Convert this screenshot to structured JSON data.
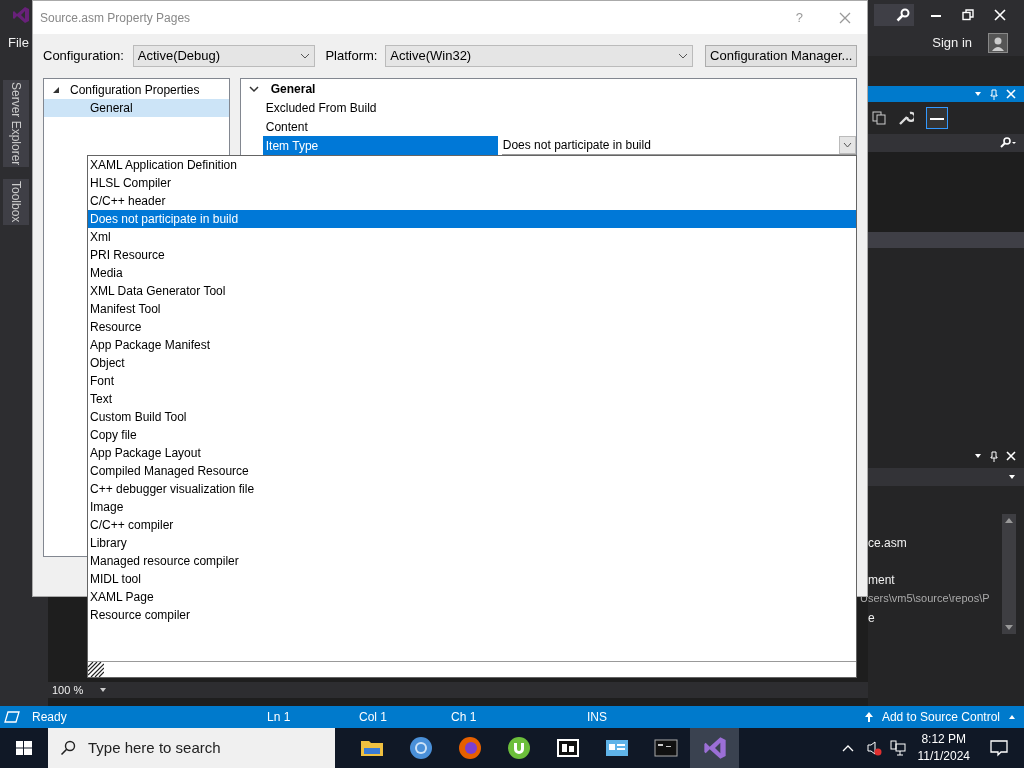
{
  "ide": {
    "menu": [
      "File"
    ],
    "sign_in": "Sign in",
    "side_tabs": [
      "Server Explorer",
      "Toolbox"
    ],
    "zoom": "100 %",
    "lower_panel_lines": [
      "ce.asm",
      "ment",
      "Users\\vm5\\source\\repos\\P",
      "e"
    ]
  },
  "dialog": {
    "title": "Source.asm Property Pages",
    "help": "?",
    "configuration_label": "Configuration:",
    "configuration_value": "Active(Debug)",
    "platform_label": "Platform:",
    "platform_value": "Active(Win32)",
    "config_manager_button": "Configuration Manager...",
    "tree": [
      {
        "label": "Configuration Properties",
        "expanded": true,
        "selected": false,
        "children": [
          {
            "label": "General",
            "selected": true
          }
        ]
      }
    ],
    "grid": {
      "category": "General",
      "expanded": true,
      "properties": [
        {
          "name": "Excluded From Build",
          "selected": false
        },
        {
          "name": "Content",
          "selected": false
        },
        {
          "name": "Item Type",
          "value": "Does not participate in build",
          "selected": true
        }
      ]
    }
  },
  "dropdown": {
    "items": [
      {
        "label": "XAML Application Definition",
        "selected": false
      },
      {
        "label": "HLSL Compiler",
        "selected": false
      },
      {
        "label": "C/C++ header",
        "selected": false
      },
      {
        "label": "Does not participate in build",
        "selected": true
      },
      {
        "label": "Xml",
        "selected": false
      },
      {
        "label": "PRI Resource",
        "selected": false
      },
      {
        "label": "Media",
        "selected": false
      },
      {
        "label": "XML Data Generator Tool",
        "selected": false
      },
      {
        "label": "Manifest Tool",
        "selected": false
      },
      {
        "label": "Resource",
        "selected": false
      },
      {
        "label": "App Package Manifest",
        "selected": false
      },
      {
        "label": "Object",
        "selected": false
      },
      {
        "label": "Font",
        "selected": false
      },
      {
        "label": "Text",
        "selected": false
      },
      {
        "label": "Custom Build Tool",
        "selected": false
      },
      {
        "label": "Copy file",
        "selected": false
      },
      {
        "label": "App Package Layout",
        "selected": false
      },
      {
        "label": "Compiled Managed Resource",
        "selected": false
      },
      {
        "label": "C++ debugger visualization file",
        "selected": false
      },
      {
        "label": "Image",
        "selected": false
      },
      {
        "label": "C/C++ compiler",
        "selected": false
      },
      {
        "label": "Library",
        "selected": false
      },
      {
        "label": "Managed resource compiler",
        "selected": false
      },
      {
        "label": "MIDL tool",
        "selected": false
      },
      {
        "label": "XAML Page",
        "selected": false
      },
      {
        "label": "Resource compiler",
        "selected": false
      }
    ]
  },
  "status_bar": {
    "items": [
      "Ready",
      "Ln 1",
      "Col 1",
      "Ch 1",
      "INS"
    ],
    "source_control": "Add to Source Control"
  },
  "taskbar": {
    "search_placeholder": "Type here to search",
    "time": "8:12 PM",
    "date": "11/1/2024"
  }
}
